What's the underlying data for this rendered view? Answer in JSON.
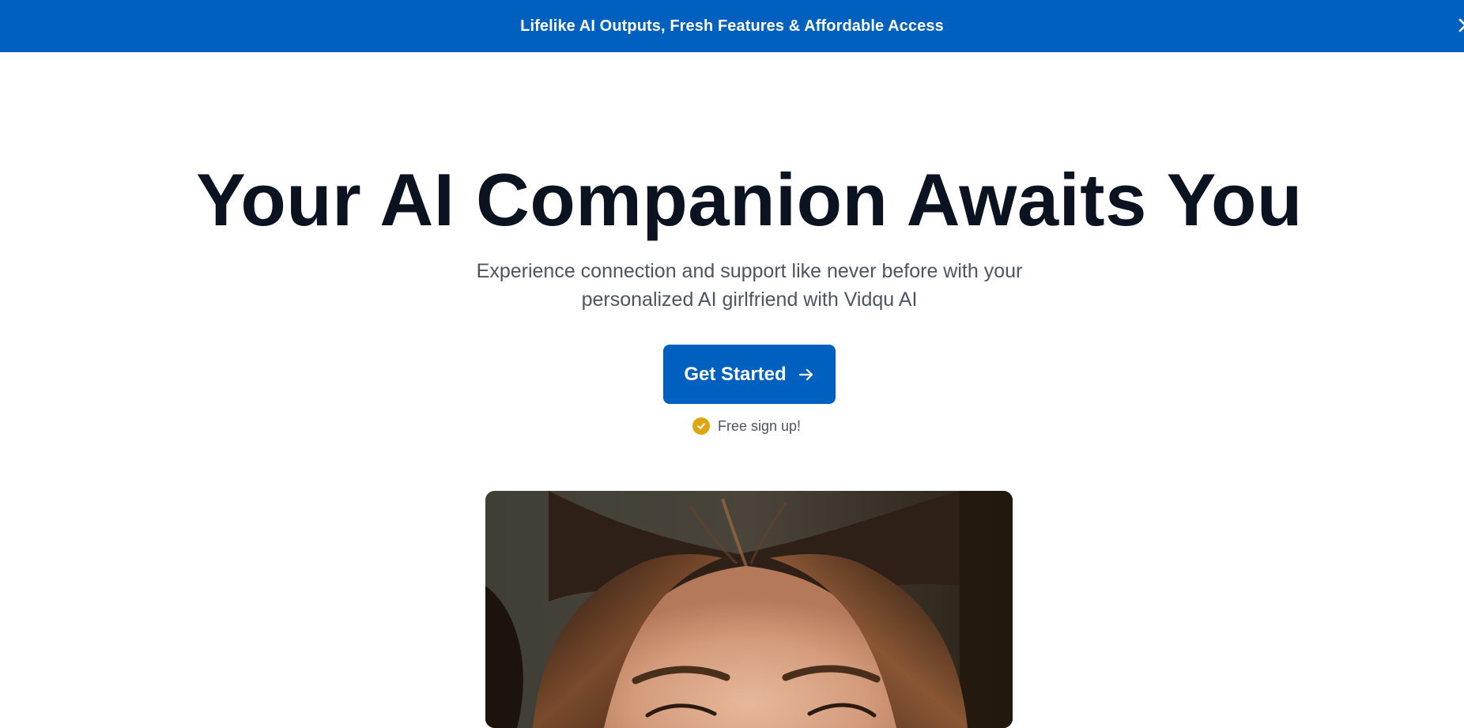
{
  "banner": {
    "text": "Lifelike AI Outputs, Fresh Features & Affordable Access",
    "close_icon": "close-icon",
    "color": "#0060c0"
  },
  "hero": {
    "title": "Your AI Companion Awaits You",
    "subtitle_line1": "Experience connection and support like never before with your",
    "subtitle_line2": "personalized AI girlfriend with Vidqu AI",
    "cta_label": "Get Started",
    "cta_icon": "arrow-right-icon",
    "cta_color": "#0060c0",
    "signup_note": "Free sign up!",
    "signup_icon": "check-circle-icon",
    "signup_icon_color": "#e0a612"
  }
}
